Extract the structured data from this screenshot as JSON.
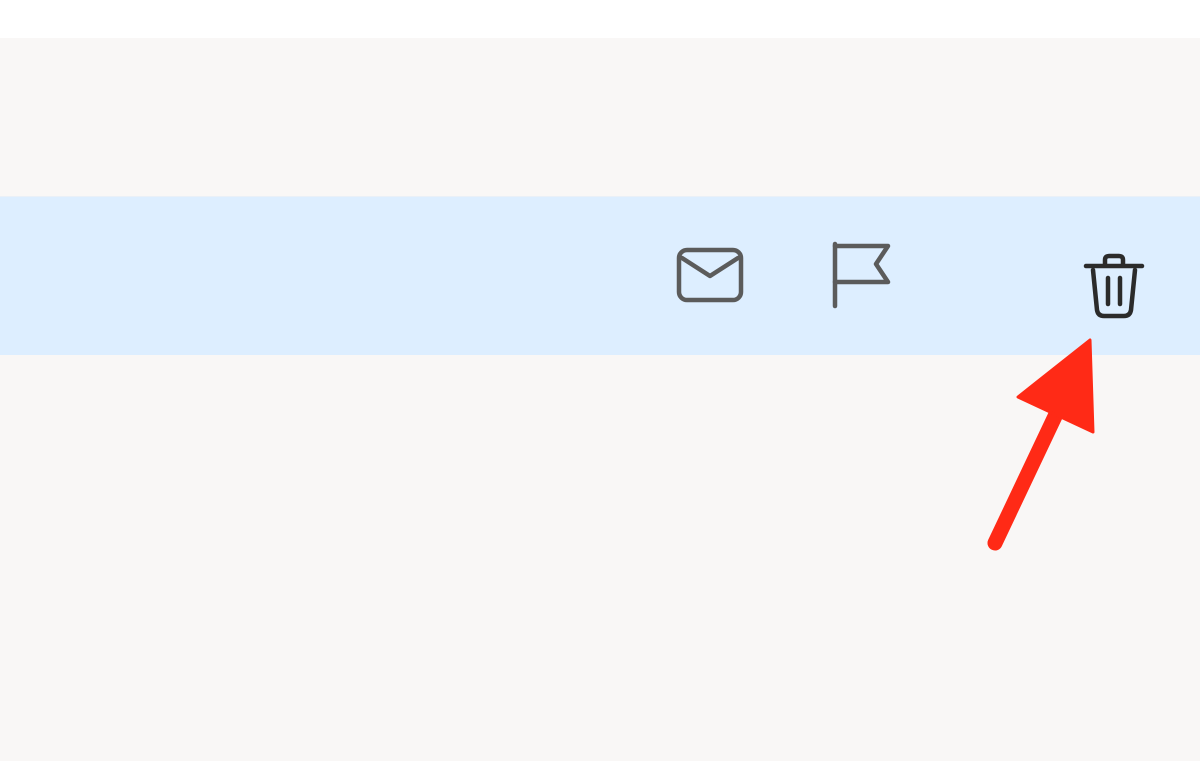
{
  "message_row": {
    "actions": [
      {
        "name": "mark-read-button",
        "icon": "envelope-icon"
      },
      {
        "name": "flag-button",
        "icon": "flag-icon"
      },
      {
        "name": "delete-button",
        "icon": "trash-icon"
      }
    ]
  },
  "annotation": {
    "type": "arrow",
    "points_to": "delete-button",
    "color": "#ff2a16"
  },
  "colors": {
    "selected_row": "#ddeeff",
    "pane_background": "#f9f7f6",
    "icon_stroke": "#5b5b5b",
    "trash_stroke": "#2b2b2b"
  }
}
